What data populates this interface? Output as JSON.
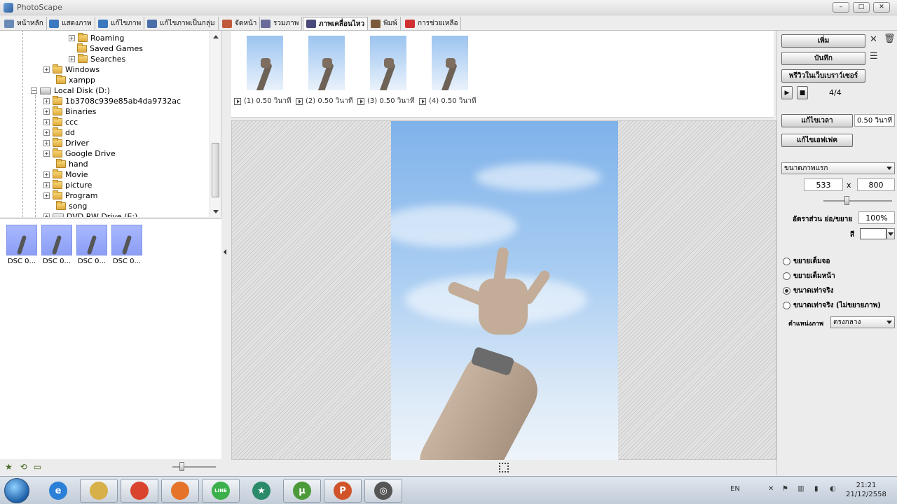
{
  "window": {
    "title": "PhotoScape",
    "controls": [
      "–",
      "□",
      "✕"
    ]
  },
  "tabs": [
    {
      "label": "หน้าหลัก",
      "icon": "home-icon",
      "color": "#6a8ab8"
    },
    {
      "label": "แสดงภาพ",
      "icon": "viewer-icon",
      "color": "#3a78c0"
    },
    {
      "label": "แก้ไขภาพ",
      "icon": "editor-icon",
      "color": "#3a78c0"
    },
    {
      "label": "แก้ไขภาพเป็นกลุ่ม",
      "icon": "batch-editor-icon",
      "color": "#4a6ea8"
    },
    {
      "label": "จัดหน้า",
      "icon": "page-icon",
      "color": "#c05a3a"
    },
    {
      "label": "รวมภาพ",
      "icon": "combine-icon",
      "color": "#6a6a9a"
    },
    {
      "label": "ภาพเคลื่อนไหว",
      "icon": "animated-gif-icon",
      "color": "#4a4a7a",
      "active": true
    },
    {
      "label": "พิมพ์",
      "icon": "print-icon",
      "color": "#7a5a3a"
    },
    {
      "label": "การช่วยเหลือ",
      "icon": "help-icon",
      "color": "#d03030"
    }
  ],
  "tree": {
    "items": [
      {
        "label": "Roaming",
        "expander": "+",
        "type": "folder"
      },
      {
        "label": "Saved Games",
        "expander": "",
        "type": "folder"
      },
      {
        "label": "Searches",
        "expander": "+",
        "type": "folder"
      },
      {
        "label": "Windows",
        "expander": "+",
        "type": "folder"
      },
      {
        "label": "xampp",
        "expander": "",
        "type": "folder"
      },
      {
        "label": "Local Disk (D:)",
        "expander": "−",
        "type": "drive"
      },
      {
        "label": "1b3708c939e85ab4da9732ac",
        "expander": "+",
        "type": "folder"
      },
      {
        "label": "Binaries",
        "expander": "+",
        "type": "folder"
      },
      {
        "label": "ccc",
        "expander": "+",
        "type": "folder"
      },
      {
        "label": "dd",
        "expander": "+",
        "type": "folder"
      },
      {
        "label": "Driver",
        "expander": "+",
        "type": "folder"
      },
      {
        "label": "Google Drive",
        "expander": "+",
        "type": "folder"
      },
      {
        "label": "hand",
        "expander": "",
        "type": "folder"
      },
      {
        "label": "Movie",
        "expander": "+",
        "type": "folder"
      },
      {
        "label": "picture",
        "expander": "+",
        "type": "folder"
      },
      {
        "label": "Program",
        "expander": "+",
        "type": "folder"
      },
      {
        "label": "song",
        "expander": "",
        "type": "folder"
      },
      {
        "label": "DVD RW Drive (E:)",
        "expander": "+",
        "type": "drive"
      }
    ]
  },
  "thumbnails": [
    {
      "label": "DSC 0..."
    },
    {
      "label": "DSC 0..."
    },
    {
      "label": "DSC 0..."
    },
    {
      "label": "DSC 0..."
    }
  ],
  "frames": [
    {
      "label": "(1) 0.50 วินาที"
    },
    {
      "label": "(2) 0.50 วินาที"
    },
    {
      "label": "(3) 0.50 วินาที"
    },
    {
      "label": "(4) 0.50 วินาที"
    }
  ],
  "right_panel": {
    "add_button": "เพิ่ม",
    "save_button": "บันทึก",
    "preview_button": "พรีวิวในเว็บเบราว์เซอร์",
    "frame_counter": "4/4",
    "change_time_button": "แก้ไขเวลา",
    "time_value": "0.50 วินาที",
    "change_effect_button": "แก้ไขเอฟเฟค",
    "size_select": "ขนาดภาพแรก",
    "width": "533",
    "by": "x",
    "height": "800",
    "ratio_label": "อัตราส่วน ย่อ/ขยาย",
    "ratio_value": "100%",
    "color_label": "สี",
    "color_value": "#ffffff",
    "fit_options": [
      {
        "label": "ขยายเต็มจอ",
        "selected": false
      },
      {
        "label": "ขยายเต็มหน้า",
        "selected": false
      },
      {
        "label": "ขนาดเท่าจริง",
        "selected": true
      },
      {
        "label": "ขนาดเท่าจริง (ไม่ขยายภาพ)",
        "selected": false
      }
    ],
    "position_label": "ตำแหน่งภาพ",
    "position_select": "ตรงกลาง"
  },
  "taskbar": {
    "apps": [
      "Windows Explorer",
      "Internet Explorer",
      "File Explorer",
      "Chrome",
      "Firefox",
      "LINE",
      "App",
      "uTorrent",
      "PowerPoint",
      "PhotoScape"
    ],
    "lang": "EN",
    "time": "21:21",
    "date": "21/12/2558"
  }
}
